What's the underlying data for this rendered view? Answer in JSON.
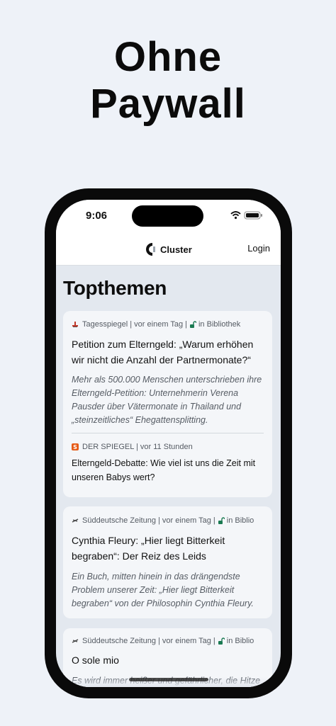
{
  "promo": {
    "line1": "Ohne",
    "line2": "Paywall"
  },
  "status": {
    "time": "9:06"
  },
  "nav": {
    "brand": "Cluster",
    "login": "Login"
  },
  "section": {
    "title": "Topthemen"
  },
  "cards": [
    {
      "source": "Tagesspiegel | vor einem Tag |",
      "library": "in Bibliothek",
      "title": "Petition zum Elterngeld: „Warum erhöhen wir nicht die Anzahl der Partnermonate?“",
      "summary": "Mehr als 500.000 Menschen unterschrieben ihre Elterngeld-Petition: Unternehmerin Verena Pausder über Vätermonate in Thailand und „steinzeitliches“ Ehegattensplitting.",
      "related": {
        "source": "DER SPIEGEL | vor 11 Stunden",
        "title": "Elterngeld-Debatte: Wie viel ist uns die Zeit mit unseren Babys wert?"
      }
    },
    {
      "source": "Süddeutsche Zeitung | vor einem Tag |",
      "library": "in Biblio",
      "title": "Cynthia Fleury: „Hier liegt Bitterkeit begraben“: Der Reiz des Leids",
      "summary": "Ein Buch, mitten hinein in das drängendste Problem unserer Zeit: „Hier liegt Bitterkeit begraben“ von der Philosophin Cynthia Fleury."
    },
    {
      "source": "Süddeutsche Zeitung | vor einem Tag |",
      "library": "in Biblio",
      "title": "O sole mio",
      "summary": "Es wird immer heißer und gefährlicher, die Hitze ist zum Verzweifeln. Außer man ist"
    }
  ],
  "icons": {
    "tagesspiegel": "tagesspiegel-icon",
    "spiegel": "spiegel-icon",
    "sz": "sz-icon",
    "lock": "unlock-icon"
  },
  "colors": {
    "background": "#eef2f8",
    "spiegel": "#e65b16",
    "lock": "#1a7a52"
  }
}
